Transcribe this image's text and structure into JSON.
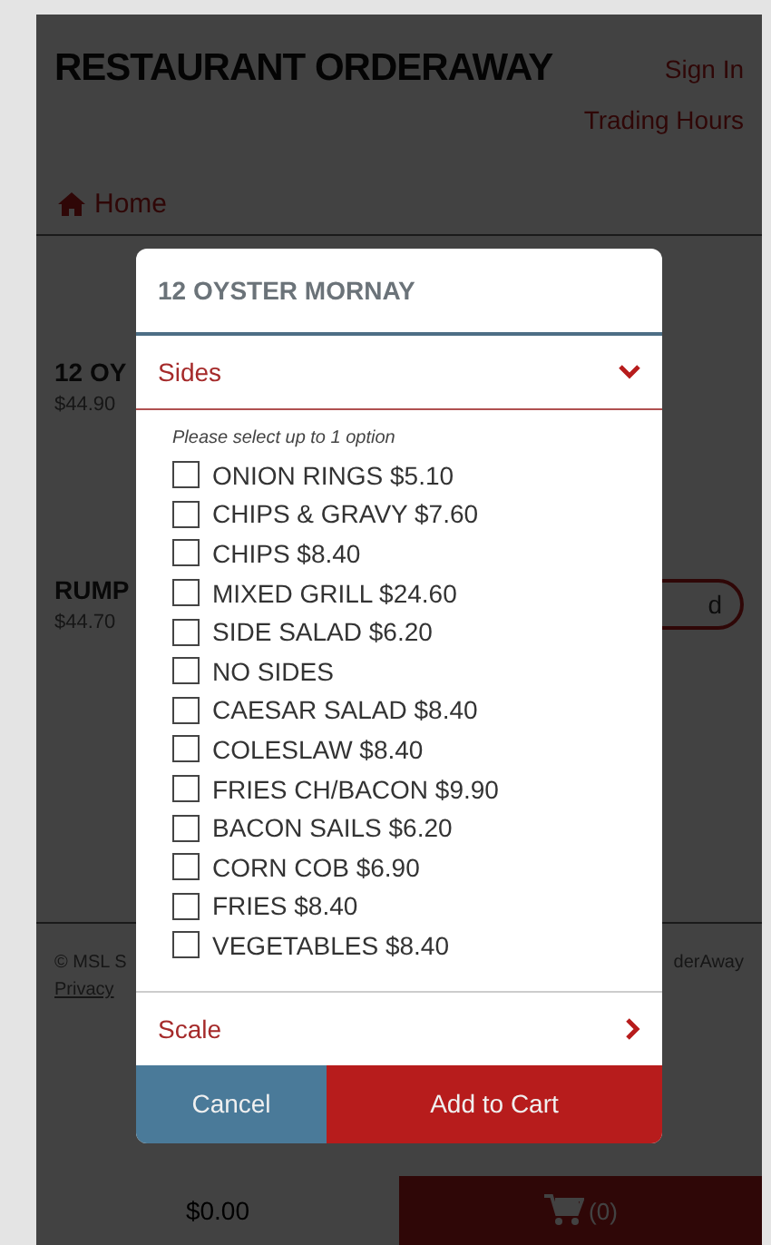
{
  "header": {
    "title": "RESTAURANT ORDERAWAY",
    "sign_in": "Sign In",
    "trading_hours": "Trading Hours"
  },
  "nav": {
    "home": "Home"
  },
  "menu_items": [
    {
      "name": "12 OY",
      "price": "$44.90"
    },
    {
      "name": "RUMP",
      "price": "$44.70",
      "button": "d"
    }
  ],
  "footer": {
    "copyright": "© MSL S",
    "privacy": "Privacy",
    "brand": "derAway"
  },
  "bottom_bar": {
    "total": "$0.00",
    "cart_count": "(0)"
  },
  "modal": {
    "title": "12 OYSTER MORNAY",
    "sections": [
      {
        "label": "Sides",
        "expanded": true,
        "hint": "Please select up to 1 option",
        "options": [
          {
            "label": "ONION RINGS $5.10",
            "checked": false
          },
          {
            "label": "CHIPS & GRAVY $7.60",
            "checked": false
          },
          {
            "label": "CHIPS $8.40",
            "checked": false
          },
          {
            "label": "MIXED GRILL $24.60",
            "checked": false
          },
          {
            "label": "SIDE SALAD $6.20",
            "checked": false
          },
          {
            "label": "NO SIDES",
            "checked": false
          },
          {
            "label": "CAESAR SALAD $8.40",
            "checked": false
          },
          {
            "label": "COLESLAW $8.40",
            "checked": false
          },
          {
            "label": "FRIES CH/BACON $9.90",
            "checked": false
          },
          {
            "label": "BACON SAILS $6.20",
            "checked": false
          },
          {
            "label": "CORN COB $6.90",
            "checked": false
          },
          {
            "label": "FRIES $8.40",
            "checked": false
          },
          {
            "label": "VEGETABLES $8.40",
            "checked": false
          }
        ]
      },
      {
        "label": "Scale",
        "expanded": false
      }
    ],
    "buttons": {
      "cancel": "Cancel",
      "add": "Add to Cart"
    }
  }
}
